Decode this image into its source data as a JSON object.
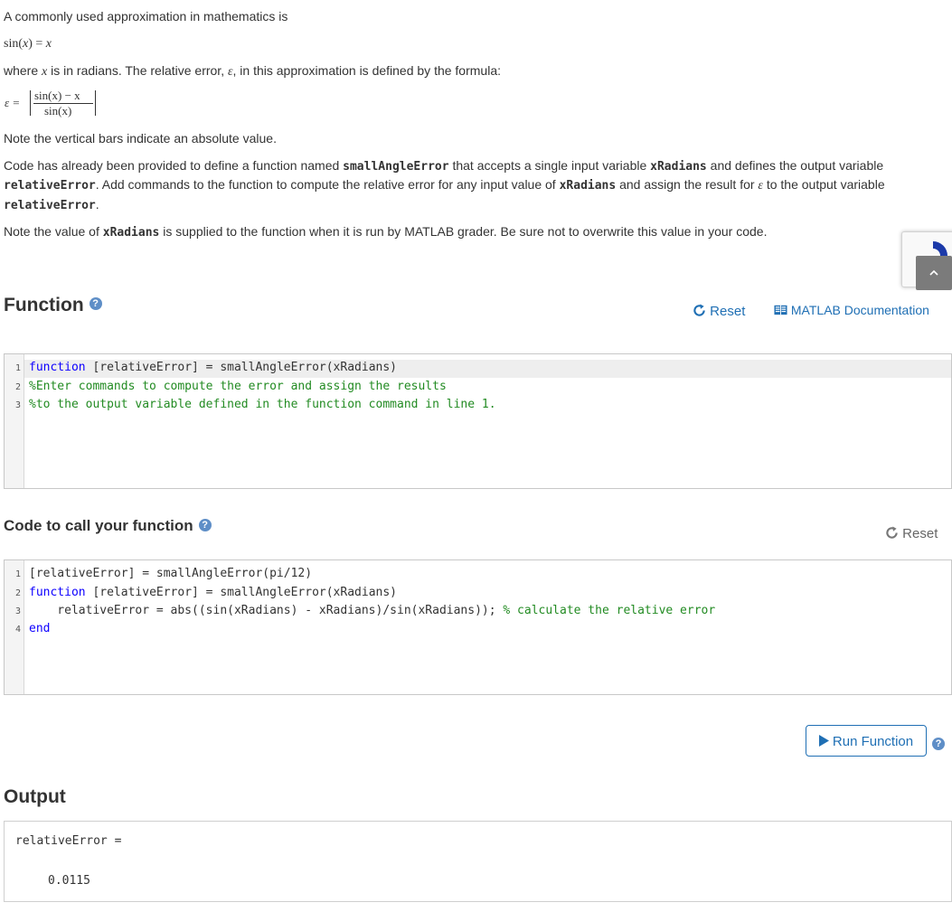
{
  "intro": {
    "line1": "A commonly used approximation in mathematics is",
    "eq1_lhs": "sin(",
    "eq1_var": "x",
    "eq1_rhs": ") = ",
    "eq1_x": "x",
    "where_a": "where ",
    "where_x": "x",
    "where_b": " is in radians. The relative error, ",
    "where_eps": "ε",
    "where_c": ", in this approximation is defined by the formula:",
    "eps_label": "ε =",
    "frac_num": "sin(x) − x",
    "frac_den": "sin(x)",
    "note_abs": "Note the vertical bars indicate an absolute value.",
    "para_a1": "Code has already been provided to define a function named ",
    "para_fn": "smallAngleError",
    "para_a2": " that accepts a single input variable ",
    "para_in": "xRadians",
    "para_a3": "  and defines the output variable",
    "para_b0": "relativeError",
    "para_b1": ".  Add commands to the function to compute the relative error for any input value of ",
    "para_b_in": "xRadians",
    "para_b2": " and assign the result for ",
    "para_b_eps": "ε",
    "para_b3": " to the output variable",
    "para_c0": "relativeError",
    "para_c1": ".",
    "note2_a": "Note the value of ",
    "note2_var": "xRadians",
    "note2_b": " is supplied to the function when it is run by MATLAB grader.  Be sure not to overwrite this value in your code."
  },
  "function_section": {
    "title": "Function",
    "help": "?",
    "reset_label": "Reset",
    "docs_label": "MATLAB Documentation",
    "lines": [
      {
        "n": "1",
        "kw": "function",
        "rest": " [relativeError] = smallAngleError(xRadians)"
      },
      {
        "n": "2",
        "comment": "%Enter commands to compute the error and assign the results"
      },
      {
        "n": "3",
        "comment": "%to the output variable defined in the function command in line 1."
      }
    ]
  },
  "call_section": {
    "title": "Code to call your function",
    "help": "?",
    "reset_label": "Reset",
    "lines": [
      {
        "n": "1",
        "code": "[relativeError] = smallAngleError(pi/12)"
      },
      {
        "n": "2",
        "kw": "function",
        "rest": " [relativeError] = smallAngleError(xRadians)"
      },
      {
        "n": "3",
        "code": "    relativeError = abs((sin(xRadians) - xRadians)/sin(xRadians)); ",
        "comment": "% calculate the relative error"
      },
      {
        "n": "4",
        "kw": "end"
      }
    ]
  },
  "run": {
    "label": "Run Function",
    "help": "?"
  },
  "output": {
    "title": "Output",
    "var_line": "relativeError =",
    "value": "0.0115"
  },
  "colors": {
    "link": "#1f6fb4",
    "keyword": "#0e00ff",
    "comment": "#228b22",
    "help_badge": "#5e8ec7"
  },
  "icons": [
    "reset-icon",
    "docs-book-icon",
    "play-icon",
    "help-icon",
    "recaptcha-icon",
    "scroll-top-icon"
  ]
}
